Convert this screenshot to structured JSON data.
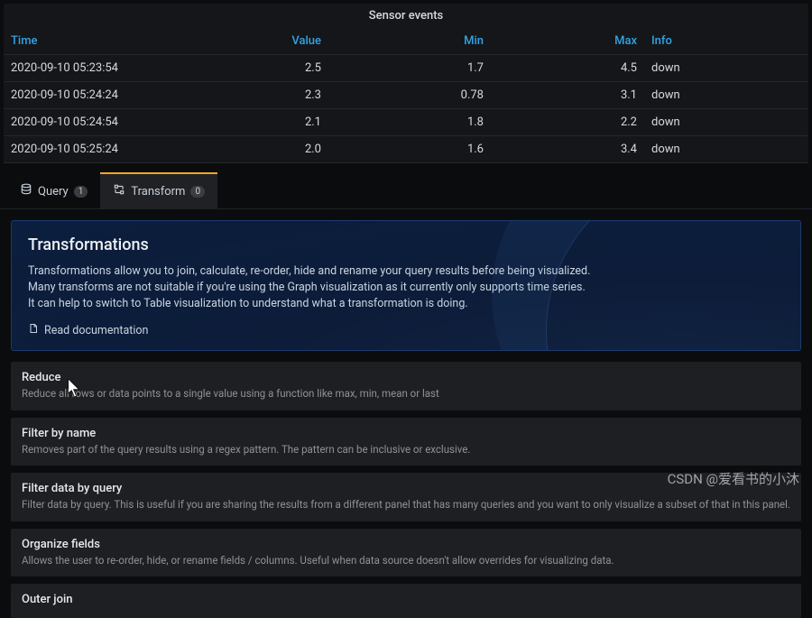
{
  "panel": {
    "title": "Sensor events"
  },
  "columns": {
    "time": "Time",
    "value": "Value",
    "min": "Min",
    "max": "Max",
    "info": "Info"
  },
  "rows": [
    {
      "time": "2020-09-10 05:23:54",
      "value": "2.5",
      "min": "1.7",
      "max": "4.5",
      "info": "down"
    },
    {
      "time": "2020-09-10 05:24:24",
      "value": "2.3",
      "min": "0.78",
      "max": "3.1",
      "info": "down"
    },
    {
      "time": "2020-09-10 05:24:54",
      "value": "2.1",
      "min": "1.8",
      "max": "2.2",
      "info": "down"
    },
    {
      "time": "2020-09-10 05:25:24",
      "value": "2.0",
      "min": "1.6",
      "max": "3.4",
      "info": "down"
    }
  ],
  "tabs": {
    "query": {
      "label": "Query",
      "count": "1"
    },
    "transform": {
      "label": "Transform",
      "count": "0"
    }
  },
  "info": {
    "title": "Transformations",
    "line1": "Transformations allow you to join, calculate, re-order, hide and rename your query results before being visualized.",
    "line2": "Many transforms are not suitable if you're using the Graph visualization as it currently only supports time series.",
    "line3": "It can help to switch to Table visualization to understand what a transformation is doing.",
    "doc": "Read documentation"
  },
  "options": [
    {
      "name": "Reduce",
      "desc": "Reduce all rows or data points to a single value using a function like max, min, mean or last"
    },
    {
      "name": "Filter by name",
      "desc": "Removes part of the query results using a regex pattern. The pattern can be inclusive or exclusive."
    },
    {
      "name": "Filter data by query",
      "desc": "Filter data by query. This is useful if you are sharing the results from a different panel that has many queries and you want to only visualize a subset of that in this panel."
    },
    {
      "name": "Organize fields",
      "desc": "Allows the user to re-order, hide, or rename fields / columns. Useful when data source doesn't allow overrides for visualizing data."
    },
    {
      "name": "Outer join",
      "desc": ""
    }
  ],
  "watermark": "CSDN @爱看书的小沐"
}
